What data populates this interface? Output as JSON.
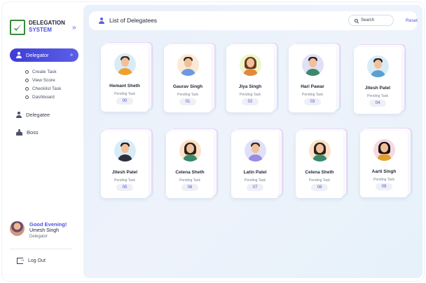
{
  "brand": {
    "line1": "DELEGATION",
    "line2": "SYSTEM",
    "collapse_icon": "chevron-double-right-icon"
  },
  "sidebar": {
    "active": {
      "label": "Delegator",
      "icon": "person-icon",
      "caret": "chevron-double-down-icon"
    },
    "subitems": [
      "Create Task",
      "View Score",
      "Checklist Task",
      "Dashboard"
    ],
    "items": [
      {
        "label": "Delegatee",
        "icon": "person-icon"
      },
      {
        "label": "Boss",
        "icon": "group-icon"
      }
    ],
    "profile": {
      "greeting": "Good Evening!",
      "name": "Umesh Singh",
      "role": "Delegator"
    },
    "logout": "Log Out"
  },
  "header": {
    "title": "List of Delegatees",
    "search_placeholder": "Search",
    "reset": "Reset"
  },
  "pending_label": "Pending Task",
  "delegatees": [
    {
      "name": "Hemant Sheth",
      "count": "00",
      "bg": "#d8ecf6",
      "shirt": "#f0a030",
      "hair": "#3a2a22",
      "long": false
    },
    {
      "name": "Gaurav Singh",
      "count": "01",
      "bg": "#fbe9d6",
      "shirt": "#6a9ae0",
      "hair": "#3a2a22",
      "long": false
    },
    {
      "name": "Jiya Singh",
      "count": "02",
      "bg": "#eef6c8",
      "shirt": "#e08a3a",
      "hair": "#6a3a20",
      "long": true
    },
    {
      "name": "Hari Pawar",
      "count": "03",
      "bg": "#e0e0f6",
      "shirt": "#3a8a6a",
      "hair": "#2a2020",
      "long": false
    },
    {
      "name": "Jitesh Patel",
      "count": "04",
      "bg": "#d8ecf6",
      "shirt": "#5aa0d0",
      "hair": "#2a2020",
      "long": false
    },
    {
      "name": "Jitesh Patel",
      "count": "05",
      "bg": "#d8ecf6",
      "shirt": "#2a3040",
      "hair": "#2a2020",
      "long": false
    },
    {
      "name": "Celena Sheth",
      "count": "06",
      "bg": "#fbe2c8",
      "shirt": "#3a8a6a",
      "hair": "#2a2020",
      "long": true
    },
    {
      "name": "Latin Patel",
      "count": "07",
      "bg": "#e0e0f6",
      "shirt": "#9a8ae0",
      "hair": "#3a2a22",
      "long": false
    },
    {
      "name": "Celena Sheth",
      "count": "08",
      "bg": "#fbe2c8",
      "shirt": "#3a8a6a",
      "hair": "#2a2020",
      "long": true
    },
    {
      "name": "Aarti Singh",
      "count": "09",
      "bg": "#f6d8e0",
      "shirt": "#e0a030",
      "hair": "#1a1414",
      "long": true
    }
  ]
}
